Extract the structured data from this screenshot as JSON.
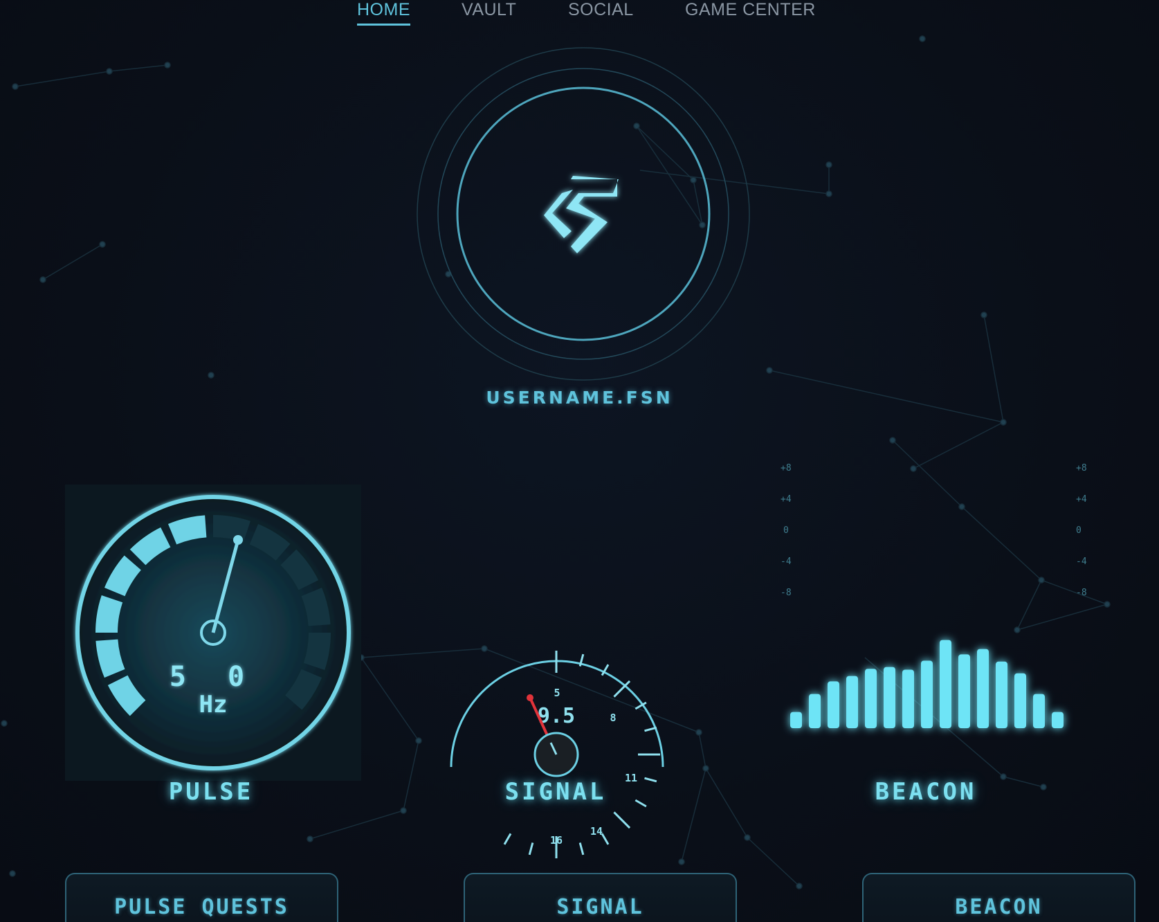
{
  "nav": {
    "items": [
      {
        "label": "HOME",
        "active": true
      },
      {
        "label": "VAULT",
        "active": false
      },
      {
        "label": "SOCIAL",
        "active": false
      },
      {
        "label": "GAME CENTER",
        "active": false
      }
    ]
  },
  "profile": {
    "username": "USERNAME.FSN",
    "logo_icon": "fusion-s-logo-icon"
  },
  "widgets": {
    "pulse": {
      "label": "PULSE",
      "value": "5 0",
      "unit": "Hz",
      "level_fraction": 0.47
    },
    "signal": {
      "label": "SIGNAL",
      "value": "9.5",
      "ticks": [
        "5",
        "8",
        "11",
        "14",
        "16"
      ]
    },
    "beacon": {
      "label": "BEACON",
      "scale": [
        "+8",
        "+4",
        "0",
        "-4",
        "-8"
      ],
      "bars": [
        0.18,
        0.38,
        0.52,
        0.58,
        0.66,
        0.68,
        0.65,
        0.75,
        0.98,
        0.82,
        0.88,
        0.74,
        0.61,
        0.38,
        0.18
      ]
    }
  },
  "bottom_buttons": {
    "pulse": "PULSE QUESTS",
    "signal": "SIGNAL",
    "beacon": "BEACON"
  },
  "colors": {
    "accent": "#5fc3dc",
    "glow": "#7ce0f0",
    "needle_red": "#e0333a",
    "background": "#0a0f18"
  }
}
